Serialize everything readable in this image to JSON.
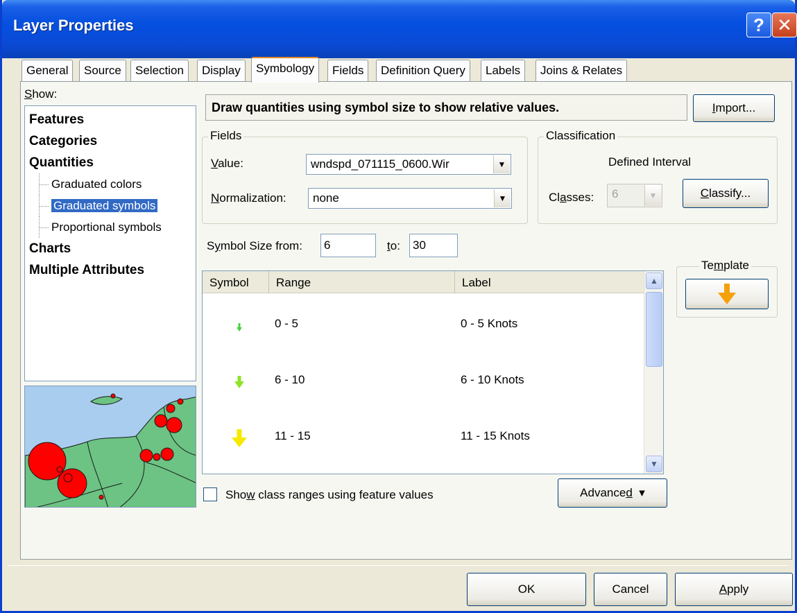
{
  "window": {
    "title": "Layer Properties",
    "help_glyph": "?",
    "close_glyph": "✕"
  },
  "tabs": [
    {
      "label": "General"
    },
    {
      "label": "Source"
    },
    {
      "label": "Selection"
    },
    {
      "label": "Display"
    },
    {
      "label": "Symbology",
      "active": true
    },
    {
      "label": "Fields"
    },
    {
      "label": "Definition Query"
    },
    {
      "label": "Labels"
    },
    {
      "label": "Joins & Relates"
    }
  ],
  "show": {
    "label_accel": "S",
    "label_rest": "how:",
    "items": [
      {
        "label": "Features",
        "level": 0
      },
      {
        "label": "Categories",
        "level": 0
      },
      {
        "label": "Quantities",
        "level": 0
      },
      {
        "label": "Graduated colors",
        "level": 1
      },
      {
        "label": "Graduated symbols",
        "level": 1,
        "selected": true
      },
      {
        "label": "Proportional symbols",
        "level": 1
      },
      {
        "label": "Charts",
        "level": 0
      },
      {
        "label": "Multiple Attributes",
        "level": 0
      }
    ]
  },
  "description": "Draw quantities using symbol size to show relative values.",
  "import_button": {
    "accel": "I",
    "rest": "mport..."
  },
  "fields": {
    "title": "Fields",
    "value_label_accel": "V",
    "value_label_rest": "alue:",
    "value": "wndspd_071115_0600.Wir",
    "normalization_label_accel": "N",
    "normalization_label_rest": "ormalization:",
    "normalization": "none"
  },
  "classification": {
    "title": "Classification",
    "method": "Defined Interval",
    "classes_label_pre": "Cl",
    "classes_label_accel": "a",
    "classes_label_rest": "sses:",
    "classes": "6",
    "classify_accel": "C",
    "classify_rest": "lassify..."
  },
  "symbol_size": {
    "from_label_pre": "S",
    "from_label_accel": "y",
    "from_label_rest": "mbol Size from:",
    "from": "6",
    "to_label_accel": "t",
    "to_label_rest": "o:",
    "to": "30"
  },
  "table": {
    "headers": {
      "symbol": "Symbol",
      "range": "Range",
      "label": "Label"
    },
    "rows": [
      {
        "range": "0 - 5",
        "label": "0 - 5 Knots",
        "color": "#4ecf3e",
        "size": 0.2
      },
      {
        "range": "6 - 10",
        "label": "6 - 10 Knots",
        "color": "#8fe22a",
        "size": 0.55
      },
      {
        "range": "11 - 15",
        "label": "11 - 15 Knots",
        "color": "#f5ea00",
        "size": 0.85
      }
    ]
  },
  "template": {
    "pre": "Te",
    "accel": "m",
    "rest": "plate",
    "color": "#f5a10c"
  },
  "show_class_ranges": {
    "pre": "Sho",
    "accel": "w",
    "rest": " class ranges using feature values",
    "checked": false
  },
  "advanced_button": {
    "pre": "Advance",
    "accel": "d",
    "arrow": "▾"
  },
  "buttons": {
    "ok": "OK",
    "cancel": "Cancel",
    "apply_accel": "A",
    "apply_rest": "pply"
  },
  "colors": {
    "title_bar": "#0550e0",
    "selection": "#316ac5",
    "map_water": "#a9cdee",
    "map_land": "#6cc383",
    "map_points": "#ff0000"
  }
}
